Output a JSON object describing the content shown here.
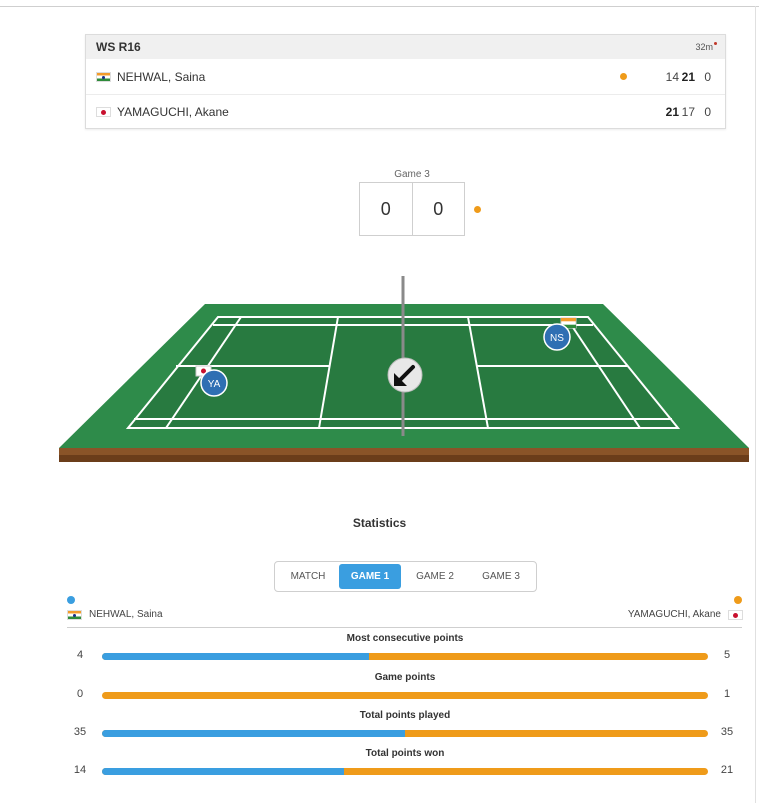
{
  "scoreboard": {
    "round": "WS R16",
    "duration": "32m",
    "players": [
      {
        "name": "NEHWAL, Saina",
        "country": "india-flag",
        "serving": true,
        "scores": [
          "14",
          "21",
          "0"
        ],
        "winning_game_index": 1
      },
      {
        "name": "YAMAGUCHI, Akane",
        "country": "japan-flag",
        "serving": false,
        "scores": [
          "21",
          "17",
          "0"
        ],
        "winning_game_index": 0
      }
    ]
  },
  "current_game": {
    "label": "Game 3",
    "left_score": "0",
    "right_score": "0"
  },
  "court": {
    "player_left_badge": "YA",
    "player_right_badge": "NS",
    "shuttle_icon": "arrow-down-left-icon",
    "court_color": "#2e8b4a",
    "badge_color": "#2f6fb3"
  },
  "statistics": {
    "title": "Statistics",
    "tabs": [
      "MATCH",
      "GAME 1",
      "GAME 2",
      "GAME 3"
    ],
    "active_tab": "GAME 1",
    "left_player": "NEHWAL, Saina",
    "right_player": "YAMAGUCHI, Akane",
    "left_color": "#3a9ee0",
    "right_color": "#ef9b1a",
    "rows": [
      {
        "label": "Most consecutive points",
        "left": "4",
        "right": "5",
        "left_share": 0.44
      },
      {
        "label": "Game points",
        "left": "0",
        "right": "1",
        "left_share": 0.0
      },
      {
        "label": "Total points played",
        "left": "35",
        "right": "35",
        "left_share": 0.5
      },
      {
        "label": "Total points won",
        "left": "14",
        "right": "21",
        "left_share": 0.4
      }
    ]
  }
}
